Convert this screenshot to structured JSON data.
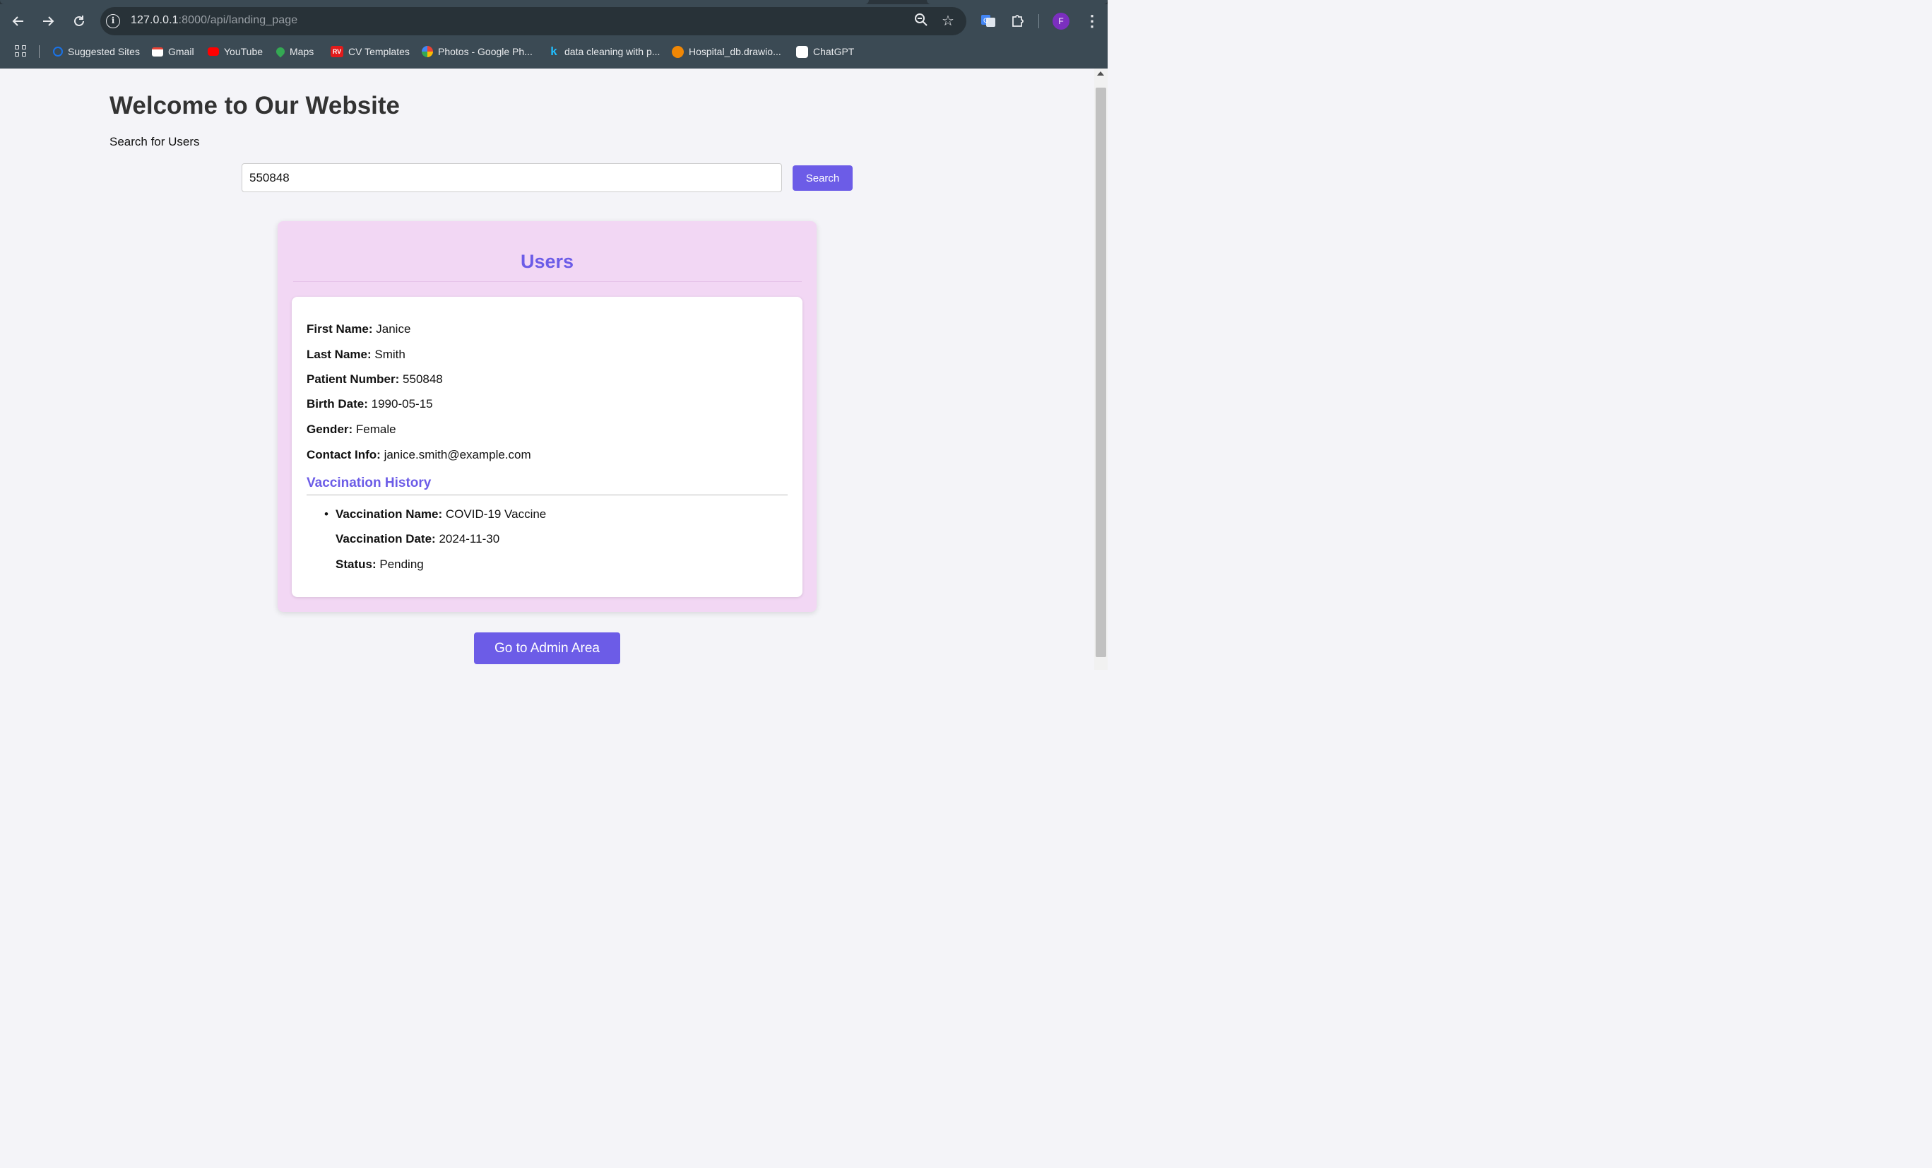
{
  "browser": {
    "url_host": "127.0.0.1",
    "url_rest": ":8000/api/landing_page",
    "profile_initial": "F",
    "bookmarks": [
      {
        "label": "Suggested Sites",
        "icon": "suggested-sites-icon",
        "color": "#1a73e8"
      },
      {
        "label": "Gmail",
        "icon": "gmail-icon",
        "color": "#ea4335"
      },
      {
        "label": "YouTube",
        "icon": "youtube-icon",
        "color": "#ff0000"
      },
      {
        "label": "Maps",
        "icon": "maps-icon",
        "color": "#34a853"
      },
      {
        "label": "CV Templates",
        "icon": "rv-icon",
        "color": "#e21b1b"
      },
      {
        "label": "Photos - Google Ph...",
        "icon": "google-photos-icon",
        "color": "#fbbc04"
      },
      {
        "label": "data cleaning with p...",
        "icon": "kaggle-icon",
        "color": "#20beff"
      },
      {
        "label": "Hospital_db.drawio...",
        "icon": "drawio-icon",
        "color": "#f08705"
      },
      {
        "label": "ChatGPT",
        "icon": "chatgpt-icon",
        "color": "#ffffff"
      }
    ]
  },
  "page": {
    "title": "Welcome to Our Website",
    "subtitle": "Search for Users",
    "search": {
      "value": "550848",
      "button": "Search"
    },
    "users": {
      "heading": "Users",
      "fields": [
        {
          "label": "First Name:",
          "value": "Janice"
        },
        {
          "label": "Last Name:",
          "value": "Smith"
        },
        {
          "label": "Patient Number:",
          "value": "550848"
        },
        {
          "label": "Birth Date:",
          "value": "1990-05-15"
        },
        {
          "label": "Gender:",
          "value": "Female"
        },
        {
          "label": "Contact Info:",
          "value": "janice.smith@example.com"
        }
      ],
      "vaccination": {
        "heading": "Vaccination History",
        "items": [
          {
            "name_label": "Vaccination Name:",
            "name": "COVID-19 Vaccine",
            "date_label": "Vaccination Date:",
            "date": "2024-11-30",
            "status_label": "Status:",
            "status": "Pending"
          }
        ]
      }
    },
    "admin_button": "Go to Admin Area"
  },
  "colors": {
    "accent": "#6c5ce7",
    "panel": "#f2d7f4",
    "chrome": "#3b4a54"
  }
}
